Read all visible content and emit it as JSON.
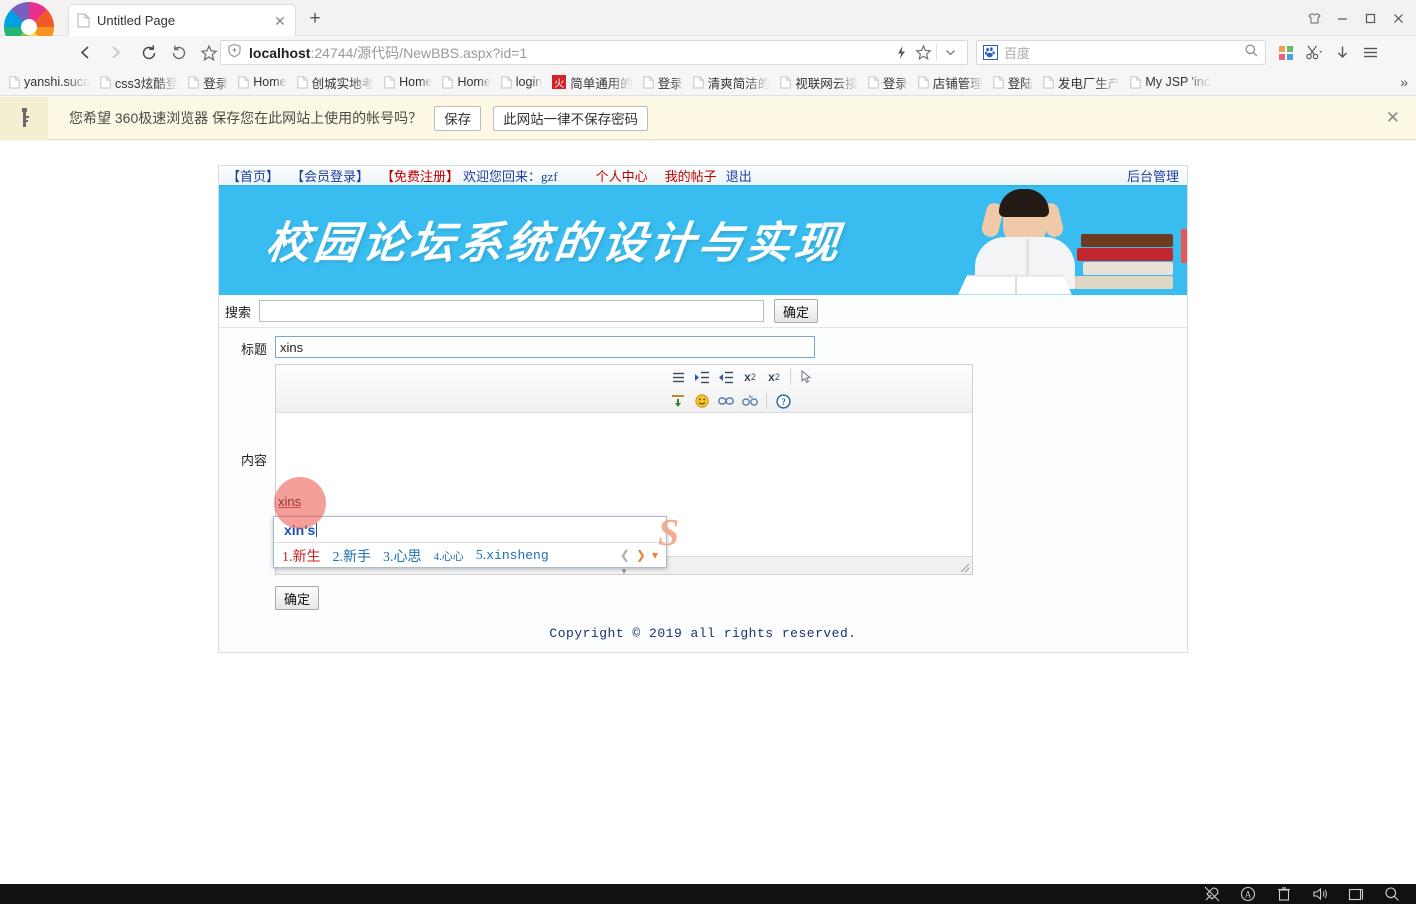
{
  "browser": {
    "tab": {
      "title": "Untitled Page",
      "favicon_icon": "document-icon",
      "close_icon": "close-icon"
    },
    "new_tab_label": "+",
    "window_controls": [
      {
        "name": "skin-button",
        "glyph": "☂"
      },
      {
        "name": "minimize-button",
        "glyph": "−"
      },
      {
        "name": "maximize-button",
        "glyph": "□"
      },
      {
        "name": "close-button",
        "glyph": "✕"
      }
    ],
    "nav": {
      "back_icon": "back-arrow-icon",
      "forward_icon": "forward-arrow-icon",
      "reload_icon": "reload-icon",
      "undo_icon": "history-back-icon",
      "bookmark_icon": "star-icon"
    },
    "address": {
      "shield_icon": "shield-icon",
      "host": "localhost",
      "path": ":24744/源代码/NewBBS.aspx?id=1",
      "lightning_icon": "lightning-icon",
      "star_icon": "star-outline-icon",
      "chevron_icon": "chevron-down-icon"
    },
    "search": {
      "engine_icon": "baidu-paw-icon",
      "placeholder": "百度",
      "value": "",
      "search_icon": "magnifier-icon"
    },
    "toolbar_right": [
      {
        "name": "apps-grid-button",
        "icon": "apps-grid-icon"
      },
      {
        "name": "screenshot-button",
        "icon": "scissors-icon"
      },
      {
        "name": "downloads-button",
        "icon": "download-arrow-icon"
      },
      {
        "name": "menu-button",
        "icon": "hamburger-menu-icon"
      }
    ],
    "bookmarks": [
      {
        "label": "yanshi.suca",
        "icon": "document-icon"
      },
      {
        "label": "css3炫酷登",
        "icon": "document-icon"
      },
      {
        "label": "登录",
        "icon": "document-icon"
      },
      {
        "label": "Home",
        "icon": "document-icon"
      },
      {
        "label": "创城实地考",
        "icon": "document-icon"
      },
      {
        "label": "Home",
        "icon": "document-icon"
      },
      {
        "label": "Home",
        "icon": "document-icon"
      },
      {
        "label": "login",
        "icon": "document-icon"
      },
      {
        "label": "简单通用的",
        "icon": "red-fire-icon"
      },
      {
        "label": "登录",
        "icon": "document-icon"
      },
      {
        "label": "清爽简洁的",
        "icon": "document-icon"
      },
      {
        "label": "视联网云接",
        "icon": "document-icon"
      },
      {
        "label": "登录",
        "icon": "document-icon"
      },
      {
        "label": "店铺管理",
        "icon": "document-icon"
      },
      {
        "label": "登陆",
        "icon": "document-icon"
      },
      {
        "label": "发电厂生产",
        "icon": "document-icon"
      },
      {
        "label": "My JSP 'ind",
        "icon": "document-icon"
      }
    ],
    "bookmarks_overflow": "»"
  },
  "infobar": {
    "key_icon": "key-icon",
    "message": "您希望 360极速浏览器 保存您在此网站上使用的帐号吗？",
    "save_label": "保存",
    "never_label": "此网站一律不保存密码",
    "close_icon": "close-icon"
  },
  "page": {
    "topnav": {
      "home": "【首页】",
      "member_login": "【会员登录】",
      "free_register": "【免费注册】",
      "welcome": "欢迎您回来：gzf",
      "personal_center": "个人中心",
      "my_posts": "我的帖子",
      "logout": "退出",
      "admin": "后台管理"
    },
    "banner": {
      "title": "校园论坛系统的设计与实现",
      "bg_color": "#39bdf0"
    },
    "search": {
      "label": "搜索",
      "value": "",
      "placeholder": "",
      "button_label": "确定"
    },
    "form": {
      "title_label": "标题",
      "title_value": "xins",
      "content_label": "内容",
      "content_value": "",
      "submit_label": "确定"
    },
    "editor_toolbar": {
      "row1": [
        {
          "name": "indent-increase-icon",
          "glyph": "→≡"
        },
        {
          "name": "indent-decrease-icon",
          "glyph": "←≡"
        },
        {
          "name": "subscript-icon",
          "glyph": "x₂"
        },
        {
          "name": "superscript-icon",
          "glyph": "x²"
        },
        {
          "name": "select-cursor-icon",
          "glyph": "➤"
        }
      ],
      "row2": [
        {
          "name": "insert-row-icon",
          "glyph": "⬇"
        },
        {
          "name": "emoji-icon",
          "glyph": "☺"
        },
        {
          "name": "insert-link-icon",
          "glyph": "⛓"
        },
        {
          "name": "remove-link-icon",
          "glyph": "✄"
        },
        {
          "name": "help-icon",
          "glyph": "?"
        }
      ]
    },
    "footer": "Copyright © 2019  all rights reserved."
  },
  "ime": {
    "composition": "xin's",
    "candidates": [
      {
        "num": "1.",
        "text": "新生"
      },
      {
        "num": "2.",
        "text": "新手"
      },
      {
        "num": "3.",
        "text": "心思"
      },
      {
        "num": "4.",
        "text": "心心"
      },
      {
        "num": "5.",
        "text": "xinsheng"
      }
    ],
    "prev_icon": "chevron-left-icon",
    "next_icon": "chevron-right-icon",
    "expand_icon": "chevron-down-icon",
    "logo": "S"
  },
  "taskbar": {
    "tray": [
      {
        "name": "rocket-icon",
        "glyph": "✈"
      },
      {
        "name": "antivirus-icon",
        "glyph": "Ⓐ"
      },
      {
        "name": "trash-icon",
        "glyph": "Ὕ1"
      },
      {
        "name": "volume-icon",
        "glyph": "🔊"
      },
      {
        "name": "window-icon",
        "glyph": "◱"
      },
      {
        "name": "search-icon",
        "glyph": "⚲"
      }
    ]
  }
}
